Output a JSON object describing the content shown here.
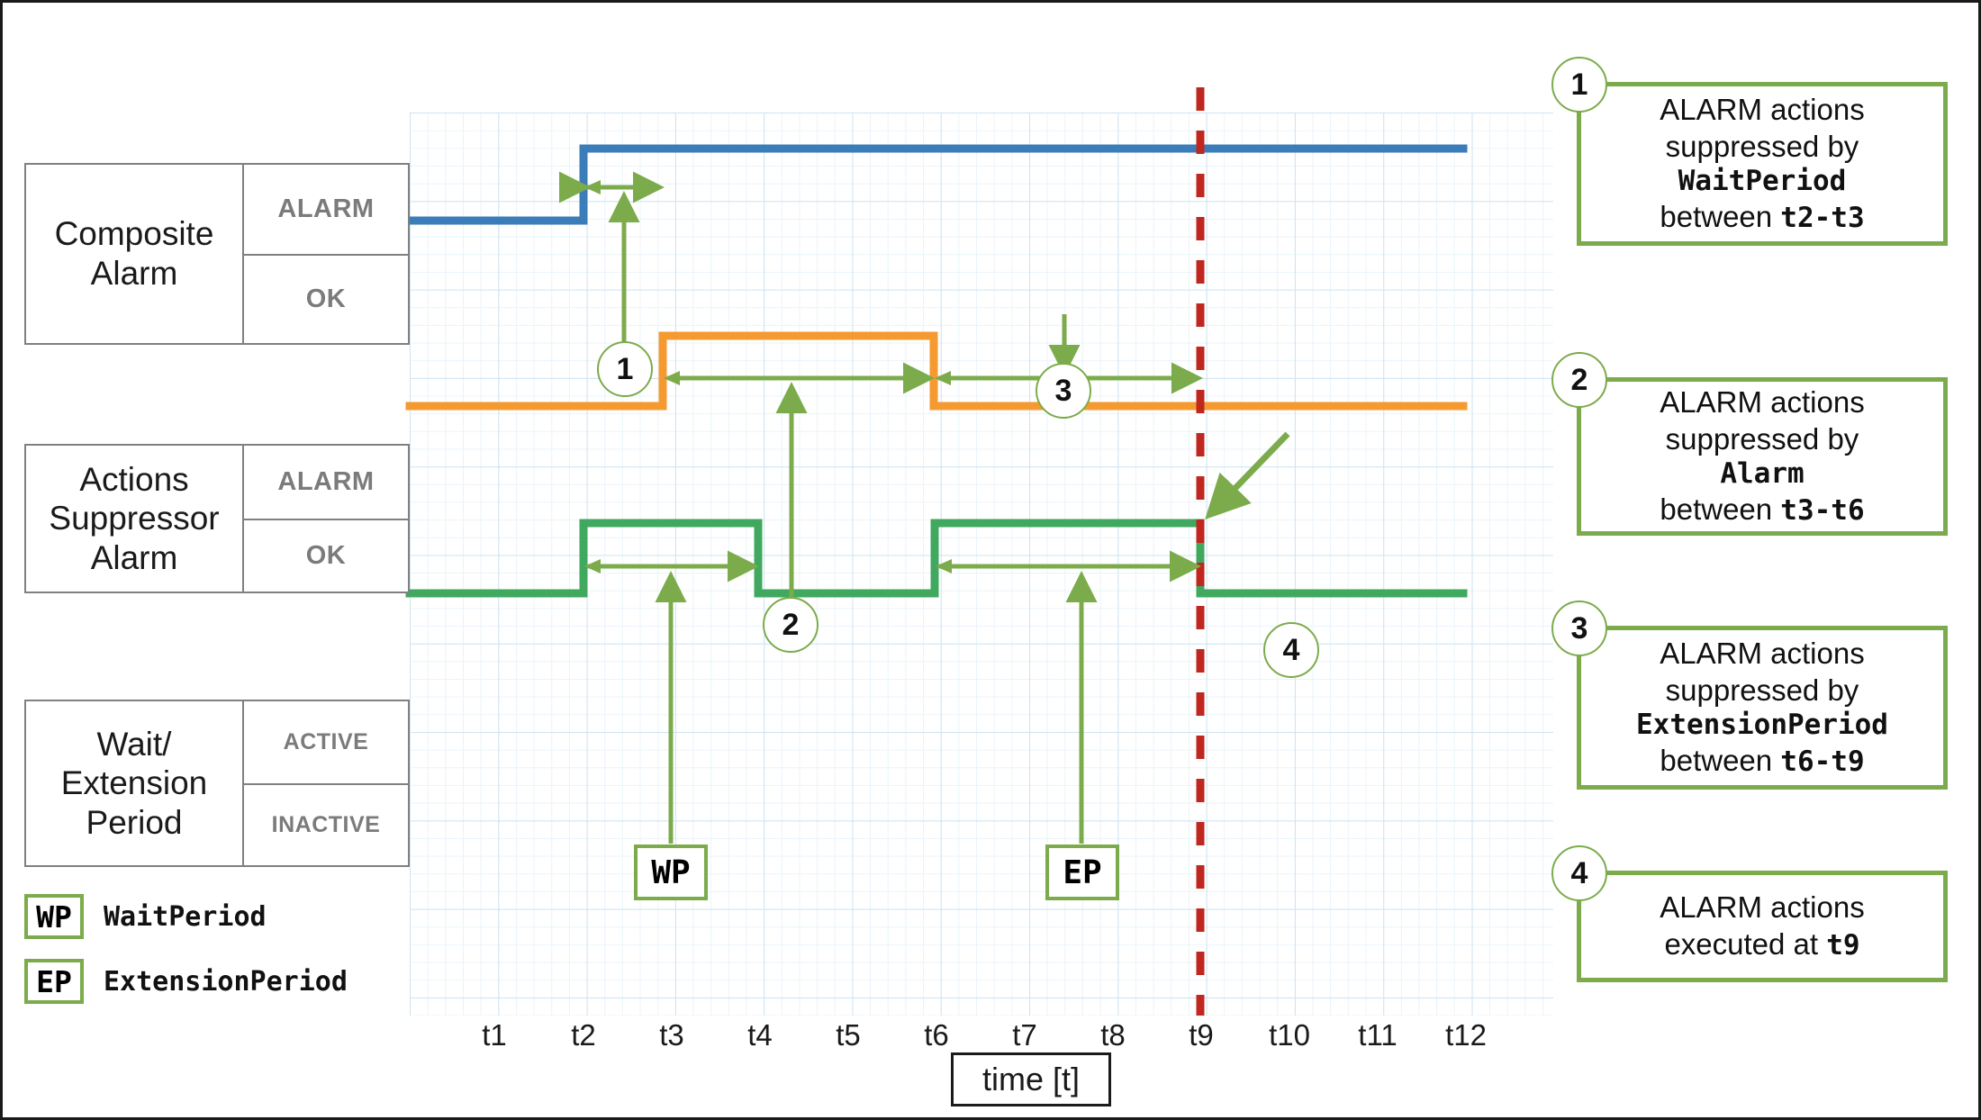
{
  "diagram": {
    "signals": [
      {
        "key": "composite",
        "name": "Composite\nAlarm",
        "name_l1": "Composite",
        "name_l2": "Alarm",
        "name_l3": "",
        "state_high": "ALARM",
        "state_low": "OK",
        "color": "#3b7db8"
      },
      {
        "key": "suppressor",
        "name": "Actions\nSuppressor\nAlarm",
        "name_l1": "Actions",
        "name_l2": "Suppressor",
        "name_l3": "Alarm",
        "state_high": "ALARM",
        "state_low": "OK",
        "color": "#f59a30"
      },
      {
        "key": "wait",
        "name": "Wait/\nExtension\nPeriod",
        "name_l1": "Wait/",
        "name_l2": "Extension",
        "name_l3": "Period",
        "state_high": "ACTIVE",
        "state_low": "INACTIVE",
        "color": "#41a85f"
      }
    ],
    "legend": [
      {
        "chip": "WP",
        "label": "WaitPeriod"
      },
      {
        "chip": "EP",
        "label": "ExtensionPeriod"
      }
    ],
    "plot_markers": [
      {
        "chip": "WP"
      },
      {
        "chip": "EP"
      }
    ],
    "callout_badges": [
      "1",
      "2",
      "3",
      "4"
    ],
    "notes": [
      {
        "num": "1",
        "l1": "ALARM actions",
        "l2": "suppressed by",
        "l3": "WaitPeriod",
        "l4_pre": "between ",
        "l4_mono": "t2-t3"
      },
      {
        "num": "2",
        "l1": "ALARM actions",
        "l2": "suppressed by",
        "l3": "Alarm",
        "l4_pre": "between ",
        "l4_mono": "t3-t6"
      },
      {
        "num": "3",
        "l1": "ALARM actions",
        "l2": "suppressed by",
        "l3": "ExtensionPeriod",
        "l4_pre": "between ",
        "l4_mono": "t6-t9"
      },
      {
        "num": "4",
        "l1": "ALARM actions",
        "l2": "",
        "l3": "",
        "l4_pre": "executed at ",
        "l4_mono": "t9"
      }
    ],
    "axis": {
      "label": "time [t]",
      "ticks": [
        "t1",
        "t2",
        "t3",
        "t4",
        "t5",
        "t6",
        "t7",
        "t8",
        "t9",
        "t10",
        "t11",
        "t12"
      ],
      "marker_time": "t9",
      "marker_color": "#c0271f"
    },
    "colors": {
      "blue": "#3b7db8",
      "orange": "#f59a30",
      "green": "#41a85f",
      "annotation_green": "#7cab4b",
      "grid": "#e9f4fb",
      "grid_major": "#cfe4f2",
      "border": "#1a1a1a",
      "state_text": "#7b7b7b"
    }
  },
  "chart_data": {
    "type": "line",
    "title": "",
    "xlabel": "time [t]",
    "ylabel": "",
    "x": [
      "t1",
      "t2",
      "t3",
      "t4",
      "t5",
      "t6",
      "t7",
      "t8",
      "t9",
      "t10",
      "t11",
      "t12"
    ],
    "grid": true,
    "legend_position": "left",
    "series": [
      {
        "name": "Composite Alarm",
        "color": "#3b7db8",
        "states": [
          "OK",
          "ALARM"
        ],
        "step": true,
        "values": [
          "OK",
          "ALARM",
          "ALARM",
          "ALARM",
          "ALARM",
          "ALARM",
          "ALARM",
          "ALARM",
          "ALARM",
          "ALARM",
          "ALARM",
          "ALARM"
        ],
        "transitions": [
          {
            "at": "t2",
            "from": "OK",
            "to": "ALARM"
          }
        ]
      },
      {
        "name": "Actions Suppressor Alarm",
        "color": "#f59a30",
        "states": [
          "OK",
          "ALARM"
        ],
        "step": true,
        "values": [
          "OK",
          "OK",
          "ALARM",
          "ALARM",
          "ALARM",
          "OK",
          "OK",
          "OK",
          "OK",
          "OK",
          "OK",
          "OK"
        ],
        "transitions": [
          {
            "at": "t3",
            "from": "OK",
            "to": "ALARM"
          },
          {
            "at": "t6",
            "from": "ALARM",
            "to": "OK"
          }
        ]
      },
      {
        "name": "Wait/Extension Period",
        "color": "#41a85f",
        "states": [
          "INACTIVE",
          "ACTIVE"
        ],
        "step": true,
        "values": [
          "INACTIVE",
          "ACTIVE",
          "ACTIVE",
          "INACTIVE",
          "INACTIVE",
          "ACTIVE",
          "ACTIVE",
          "ACTIVE",
          "INACTIVE",
          "INACTIVE",
          "INACTIVE",
          "INACTIVE"
        ],
        "transitions": [
          {
            "at": "t2",
            "from": "INACTIVE",
            "to": "ACTIVE"
          },
          {
            "at": "t4",
            "from": "ACTIVE",
            "to": "INACTIVE"
          },
          {
            "at": "t6",
            "from": "INACTIVE",
            "to": "ACTIVE"
          },
          {
            "at": "t9",
            "from": "ACTIVE",
            "to": "INACTIVE"
          }
        ]
      }
    ],
    "spans": [
      {
        "id": "1",
        "label": "WaitPeriod suppression",
        "from": "t2",
        "to": "t3",
        "row": "composite"
      },
      {
        "id": "2",
        "label": "Alarm suppression",
        "from": "t3",
        "to": "t6",
        "row": "suppressor"
      },
      {
        "id": "3",
        "label": "ExtensionPeriod suppression",
        "from": "t6",
        "to": "t9",
        "row": "suppressor"
      },
      {
        "id": "WP",
        "label": "WaitPeriod",
        "from": "t2",
        "to": "t4",
        "row": "wait"
      },
      {
        "id": "EP",
        "label": "ExtensionPeriod",
        "from": "t6",
        "to": "t9",
        "row": "wait"
      }
    ],
    "annotations": [
      {
        "id": "4",
        "label": "ALARM actions executed at t9",
        "at": "t9"
      }
    ]
  }
}
